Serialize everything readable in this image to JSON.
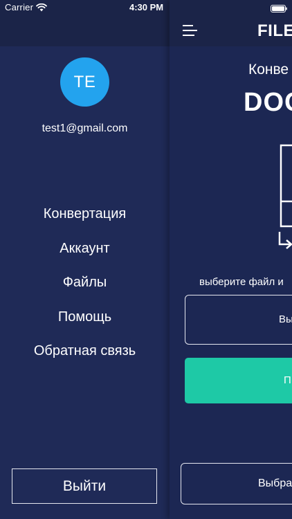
{
  "status_bar": {
    "carrier": "Carrier",
    "time": "4:30 PM",
    "wifi_icon": "wifi-icon",
    "battery_icon": "battery-icon"
  },
  "menu": {
    "avatar_initials": "TE",
    "email": "test1@gmail.com",
    "items": [
      {
        "label": "Конвертация"
      },
      {
        "label": "Аккаунт"
      },
      {
        "label": "Файлы"
      },
      {
        "label": "Помощь"
      },
      {
        "label": "Обратная связь"
      }
    ],
    "logout_label": "Выйти"
  },
  "main": {
    "menu_icon": "hamburger-icon",
    "app_title": "FILE",
    "subtitle": "Конве",
    "format_name": "DOC",
    "document_icon": "document-icon",
    "select_hint": "выберите файл и",
    "choose_file_label": "Вы",
    "convert_label": "П",
    "bottom_button_label": "Выбрать"
  },
  "colors": {
    "background": "#1c2753",
    "header": "#1b2448",
    "avatar": "#23a3ee",
    "accent": "#1ec9a6",
    "text": "#ffffff"
  }
}
